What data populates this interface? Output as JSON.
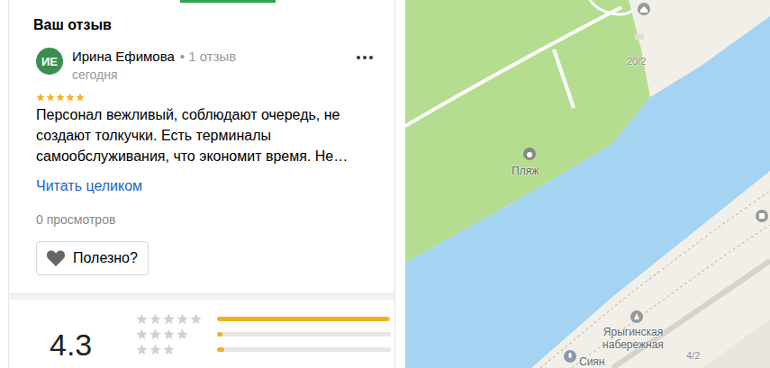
{
  "header": {
    "title": "Ваш отзыв"
  },
  "review": {
    "avatar": "ИЕ",
    "author": "Ирина Ефимова",
    "author_meta": "• 1 отзыв",
    "date": "сегодня",
    "stars": 5,
    "text": "Персонал вежливый, соблюдают очередь, не создают толкучки. Есть терминалы самообслуживания, что экономит время. Не…",
    "read_more": "Читать целиком",
    "views": "0 просмотров",
    "helpful": "Полезно?"
  },
  "rating": {
    "value": "4.3",
    "rows": [
      {
        "star_count": 5,
        "level": 0.99
      },
      {
        "star_count": 4,
        "level": 0.03
      },
      {
        "star_count": 3,
        "level": 0.04
      }
    ]
  },
  "map": {
    "labels": [
      {
        "text": "Пляж",
        "kind": "poi"
      },
      {
        "text": "20/2",
        "kind": "house"
      },
      {
        "text": "Ярыгинская набережная",
        "kind": "poi"
      },
      {
        "text": "4/2",
        "kind": "house"
      },
      {
        "text": "Сиян",
        "kind": "poi"
      }
    ]
  }
}
